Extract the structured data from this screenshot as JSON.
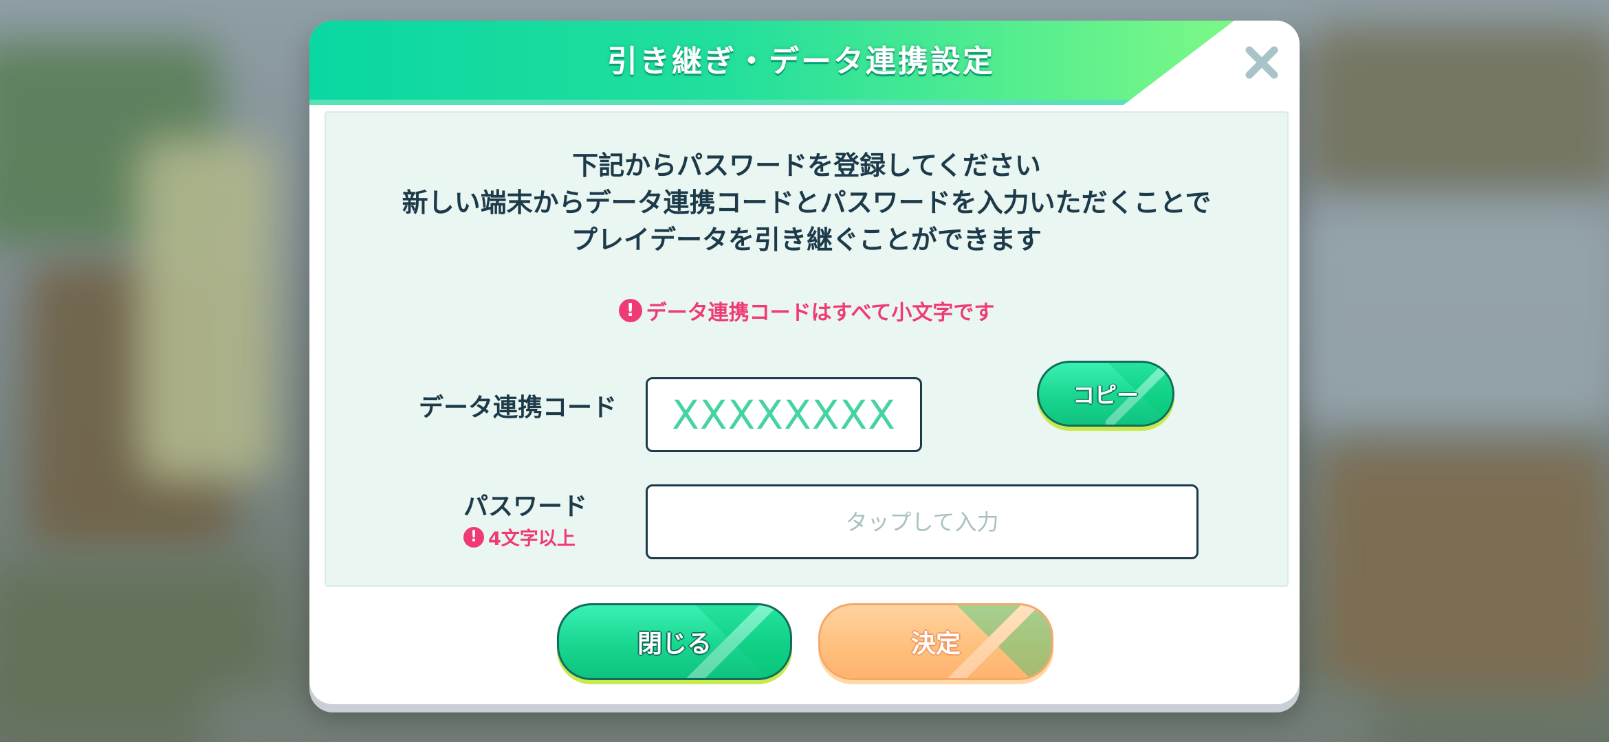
{
  "dialog": {
    "title": "引き継ぎ・データ連携設定",
    "close_icon": "close-x-icon"
  },
  "panel": {
    "description_lines": [
      "下記からパスワードを登録してください",
      "新しい端末からデータ連携コードとパスワードを入力いただくことで",
      "プレイデータを引き継ぐことができます"
    ],
    "notice": "データ連携コードはすべて小文字です",
    "code_label": "データ連携コード",
    "code_value": "XXXXXXXX",
    "copy_label": "コピー",
    "password_label": "パスワード",
    "password_hint": "4文字以上",
    "password_placeholder": "タップして入力",
    "password_value": ""
  },
  "buttons": {
    "close_label": "閉じる",
    "ok_label": "決定"
  },
  "colors": {
    "accent": "#1fd99a",
    "warning": "#ef3b74",
    "text": "#1c3a4a",
    "confirm": "#ffbf7c"
  }
}
